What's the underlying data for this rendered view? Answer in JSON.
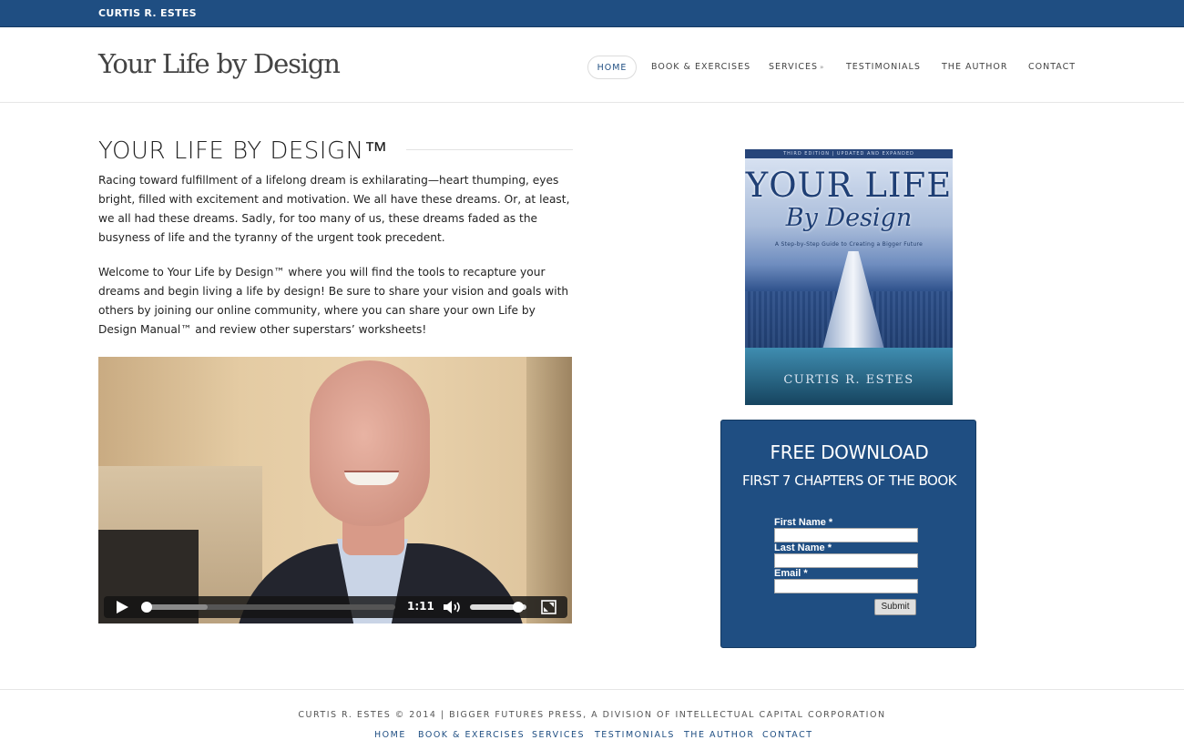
{
  "topbar": {
    "name": "CURTIS R. ESTES"
  },
  "header": {
    "logo": "Your Life by Design",
    "nav": [
      {
        "label": "HOME",
        "active": true
      },
      {
        "label": "BOOK & EXERCISES"
      },
      {
        "label": "SERVICES",
        "has_dropdown": true,
        "dropdown_icon": "double-chevron-down-icon"
      },
      {
        "label": "TESTIMONIALS"
      },
      {
        "label": "THE AUTHOR"
      },
      {
        "label": "CONTACT"
      }
    ]
  },
  "main": {
    "title": "YOUR LIFE BY DESIGN™",
    "paragraphs": [
      "Racing toward fulfillment of a lifelong dream is exhilarating—heart thumping, eyes bright, filled with excitement and motivation. We all have these dreams. Or, at least, we all had these dreams. Sadly, for too many of us, these dreams faded as the busyness of life and the tyranny of the urgent took precedent.",
      "Welcome to Your Life by Design™ where you will find the tools to recapture your dreams and begin living a life by design! Be sure to share your vision and goals with others by joining our online community, where you can share your own Life by Design Manual™ and review other superstars’ worksheets!"
    ],
    "video": {
      "duration": "1:11",
      "progress_fraction": 0,
      "volume_fraction": 0.9,
      "icons": [
        "play-icon",
        "volume-icon",
        "fullscreen-icon"
      ]
    }
  },
  "sidebar": {
    "book": {
      "edition_band": "THIRD EDITION | UPDATED AND EXPANDED",
      "title_line1": "YOUR LIFE",
      "title_line2": "By Design",
      "subtitle": "A Step-by-Step Guide to Creating a Bigger Future",
      "author": "CURTIS R. ESTES"
    },
    "download": {
      "title": "FREE DOWNLOAD",
      "subtitle": "FIRST 7 CHAPTERS OF THE BOOK",
      "fields": [
        {
          "label": "First Name *",
          "value": ""
        },
        {
          "label": "Last Name *",
          "value": ""
        },
        {
          "label": "Email *",
          "value": ""
        }
      ],
      "submit_label": "Submit"
    }
  },
  "footer": {
    "copyright": "CURTIS R. ESTES © 2014 | BIGGER FUTURES PRESS, A DIVISION OF INTELLECTUAL CAPITAL CORPORATION",
    "nav": [
      "HOME",
      "BOOK & EXERCISES",
      "SERVICES",
      "TESTIMONIALS",
      "THE AUTHOR",
      "CONTACT"
    ]
  },
  "colors": {
    "brand_blue": "#1f4e82",
    "text": "#222222",
    "border": "#e6e6e6"
  }
}
